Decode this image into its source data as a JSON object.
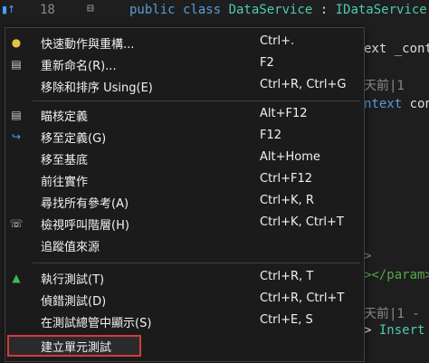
{
  "editor": {
    "line_number": "18",
    "lines": {
      "line1_kw": "public class ",
      "line1_cls": "DataService",
      "line1_sep": " : ",
      "line1_iface": "IDataService",
      "line2": "ext _cont",
      "line3": "天前|1",
      "line4_kw": "ntext",
      "line4_rest": " con",
      "line5": ">",
      "line6": "></param>",
      "line7": "天前|1 -",
      "line8_lt": "> ",
      "line8_ident": "Insert"
    }
  },
  "context_menu": {
    "items": [
      {
        "label": "快速動作與重構...",
        "shortcut": "Ctrl+.",
        "icon": "lightbulb-icon"
      },
      {
        "label": "重新命名(R)...",
        "shortcut": "F2",
        "icon": "rename-icon"
      },
      {
        "label": "移除和排序 Using(E)",
        "shortcut": "Ctrl+R, Ctrl+G",
        "icon": ""
      },
      {
        "label": "瞄核定義",
        "shortcut": "Alt+F12",
        "icon": "peek-definition-icon"
      },
      {
        "label": "移至定義(G)",
        "shortcut": "F12",
        "icon": "go-to-definition-icon"
      },
      {
        "label": "移至基底",
        "shortcut": "Alt+Home",
        "icon": ""
      },
      {
        "label": "前往實作",
        "shortcut": "Ctrl+F12",
        "icon": ""
      },
      {
        "label": "尋找所有參考(A)",
        "shortcut": "Ctrl+K, R",
        "icon": ""
      },
      {
        "label": "檢視呼叫階層(H)",
        "shortcut": "Ctrl+K, Ctrl+T",
        "icon": "call-hierarchy-icon"
      },
      {
        "label": "追蹤值來源",
        "shortcut": "",
        "icon": ""
      },
      {
        "label": "執行測試(T)",
        "shortcut": "Ctrl+R, T",
        "icon": "flask-icon"
      },
      {
        "label": "偵錯測試(D)",
        "shortcut": "Ctrl+R, Ctrl+T",
        "icon": ""
      },
      {
        "label": "在測試總管中顯示(S)",
        "shortcut": "Ctrl+E, S",
        "icon": ""
      },
      {
        "label": "建立單元測試",
        "shortcut": "",
        "icon": ""
      }
    ]
  },
  "colors": {
    "highlight_border": "#d63a3a",
    "keyword": "#569cd6",
    "class_name": "#4ec9b0"
  }
}
